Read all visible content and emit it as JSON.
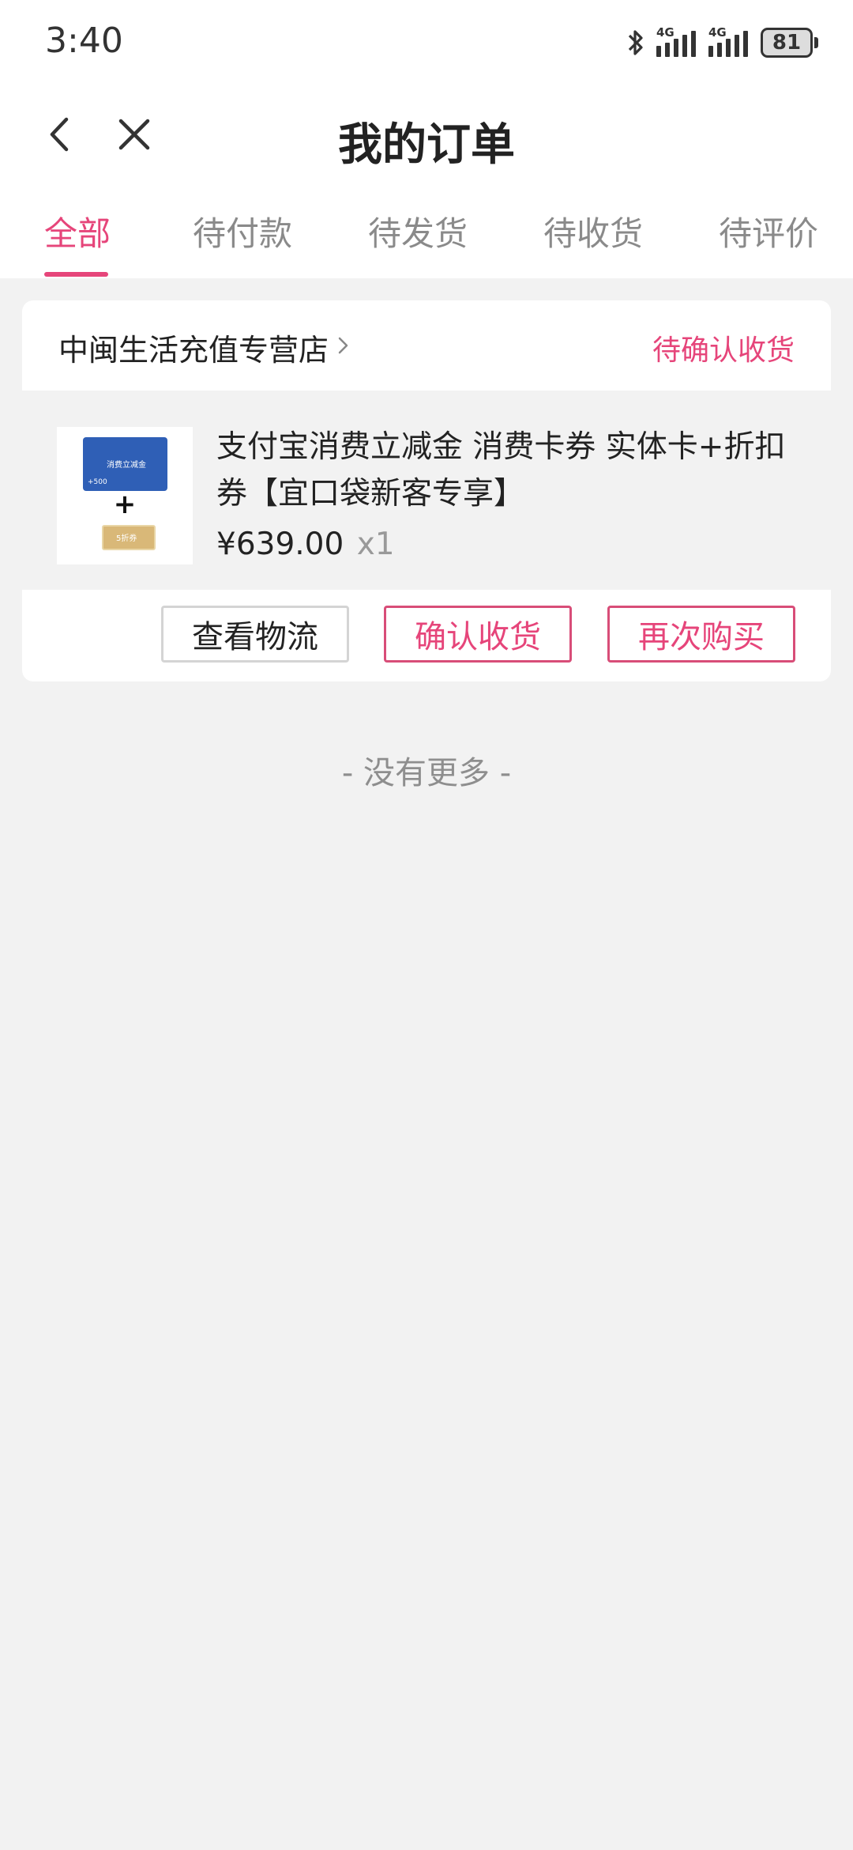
{
  "status_bar": {
    "time": "3:40",
    "network_1": "4G",
    "network_2": "4G",
    "battery": "81",
    "icons": [
      "bluetooth-icon",
      "signal-icon",
      "signal-icon",
      "battery-icon"
    ]
  },
  "header": {
    "title": "我的订单",
    "back_icon": "chevron-left-icon",
    "close_icon": "close-icon"
  },
  "tabs": [
    {
      "label": "全部",
      "active": true
    },
    {
      "label": "待付款",
      "active": false
    },
    {
      "label": "待发货",
      "active": false
    },
    {
      "label": "待收货",
      "active": false
    },
    {
      "label": "待评价",
      "active": false
    }
  ],
  "order": {
    "shop_name": "中闽生活充值专营店",
    "status": "待确认收货",
    "product": {
      "title": "支付宝消费立减金 消费卡券 实体卡+折扣券【宜口袋新客专享】",
      "price": "¥639.00",
      "quantity": "x1",
      "thumb_card_text": "消费立减金",
      "thumb_card_value": "+500",
      "thumb_plus": "+",
      "thumb_coupon_text": "5折券"
    },
    "actions": {
      "logistics": "查看物流",
      "confirm": "确认收货",
      "rebuy": "再次购买"
    }
  },
  "footer": {
    "no_more": "- 没有更多 -"
  },
  "colors": {
    "accent": "#e6457a",
    "background": "#f2f2f2"
  }
}
